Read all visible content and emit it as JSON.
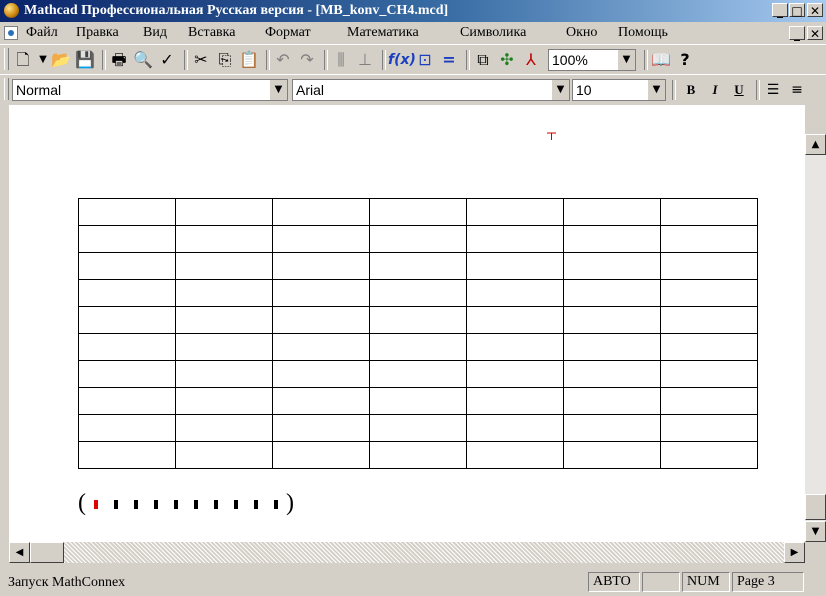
{
  "window": {
    "title": "Mathcad Профессиональная Русская версия - [MB_konv_CH4.mcd]"
  },
  "menu": {
    "items": [
      {
        "label": "Файл"
      },
      {
        "label": "Правка"
      },
      {
        "label": "Вид"
      },
      {
        "label": "Вставка"
      },
      {
        "label": "Формат"
      },
      {
        "label": "Математика"
      },
      {
        "label": "Символика"
      },
      {
        "label": "Окно"
      },
      {
        "label": "Помощь"
      }
    ]
  },
  "toolbar": {
    "zoom": "100%",
    "icons": [
      "new-icon",
      "open-icon",
      "save-icon",
      "print-icon",
      "print-preview-icon",
      "spellcheck-icon",
      "cut-icon",
      "copy-icon",
      "paste-icon",
      "undo-icon",
      "redo-icon",
      "align-icon",
      "function-icon",
      "unit-icon",
      "equals-icon",
      "resource-icon",
      "component-icon",
      "insert-icon",
      "help-icon"
    ]
  },
  "format_bar": {
    "style": "Normal",
    "font": "Arial",
    "size": "10",
    "bold": "B",
    "italic": "I",
    "underline": "U"
  },
  "worksheet": {
    "table_rows": 10,
    "table_cols": 7,
    "vector_placeholders": 10
  },
  "status": {
    "message": "Запуск MathConnex",
    "mode": "АВТО",
    "empty_pane": "",
    "num": "NUM",
    "page": "Page 3"
  }
}
